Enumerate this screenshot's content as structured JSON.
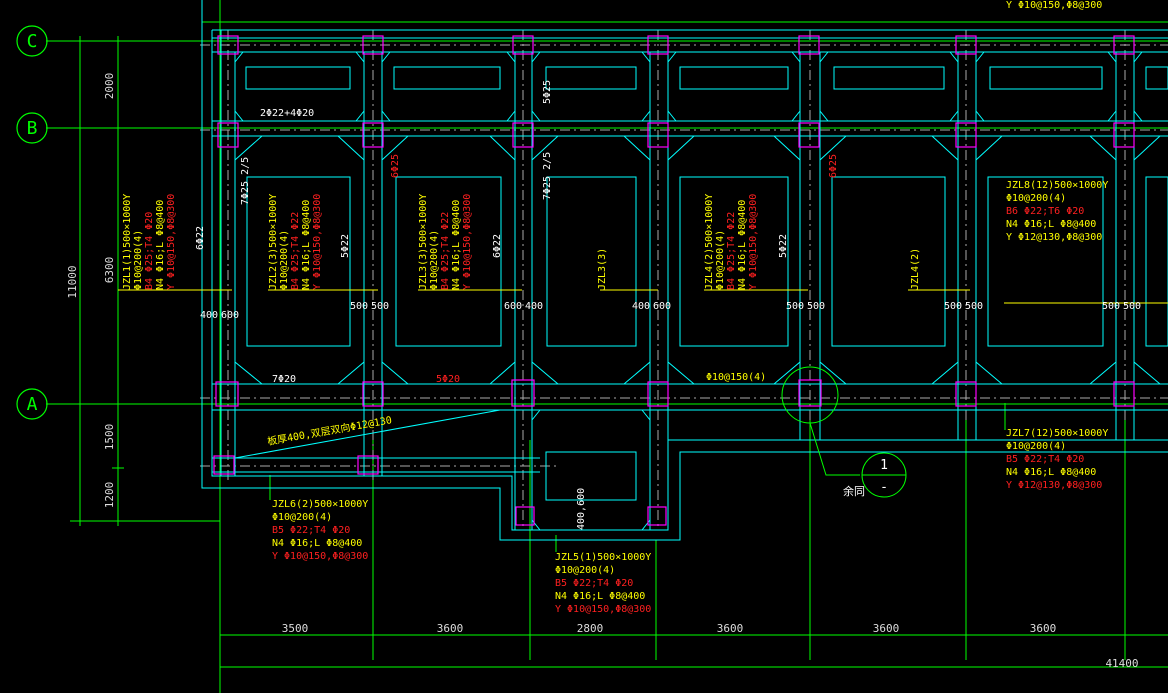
{
  "colors": {
    "background": "#000000",
    "axis": "#00ff00",
    "beam_outline": "#00ffff",
    "column": "#ff00ff",
    "annotation_main": "#ffff00",
    "annotation_extra": "#ff2020",
    "dimension_text": "#dddddd"
  },
  "axes": [
    "C",
    "B",
    "A"
  ],
  "top_note": "Y Φ10@150,Φ8@300",
  "vertical_dims": [
    "2000",
    "6300",
    "1500",
    "1200"
  ],
  "vertical_total": "11000",
  "bottom_dims": [
    "3500",
    "3600",
    "2800",
    "3600",
    "3600",
    "3600"
  ],
  "bottom_total": "41400",
  "beam_labels": {
    "jzl1": [
      "JZL1(1)500×1000Y",
      "Φ10@200(4)",
      "B4 Φ25;T4 Φ20",
      "N4 Φ16;L Φ8@400",
      "Y Φ10@150,Φ8@300"
    ],
    "jzl2": [
      "JZL2(3)500×1000Y",
      "Φ10@200(4)",
      "B4 Φ25;T4 Φ22",
      "N4 Φ16;L Φ8@400",
      "Y Φ10@150,Φ8@300"
    ],
    "jzl3": [
      "JZL3(3)500×1000Y",
      "Φ10@200(4)",
      "B4 Φ25;T4 Φ22",
      "N4 Φ16;L Φ8@400",
      "Y Φ10@150,Φ8@300"
    ],
    "jzl4": [
      "JZL4(2)500×1000Y",
      "Φ10@200(4)",
      "B4 Φ25;T4 Φ22",
      "N4 Φ16;L Φ8@400",
      "Y Φ10@150,Φ8@300"
    ],
    "jzl3_short": "JZL3(3)",
    "jzl4_short": "JZL4(2)",
    "jzl8": [
      "JZL8(12)500×1000Y",
      "Φ10@200(4)",
      "B6 Φ22;T6 Φ20",
      "N4 Φ16;L Φ8@400",
      "Y Φ12@130,Φ8@300"
    ],
    "jzl7": [
      "JZL7(12)500×1000Y",
      "Φ10@200(4)",
      "B5 Φ22;T4 Φ20",
      "N4 Φ16;L Φ8@400",
      "Y Φ12@130,Φ8@300"
    ],
    "jzl6": [
      "JZL6(2)500×1000Y",
      "Φ10@200(4)",
      "B5 Φ22;T4 Φ20",
      "N4 Φ16;L Φ8@400",
      "Y Φ10@150,Φ8@300"
    ],
    "jzl5": [
      "JZL5(1)500×1000Y",
      "Φ10@200(4)",
      "B5 Φ22;T4 Φ20",
      "N4 Φ16;L Φ8@400",
      "Y Φ10@150,Φ8@300"
    ]
  },
  "rebar_notes": {
    "top_span": "2Φ22+4Φ20",
    "n1": "5Φ25",
    "v1": "7Φ25 2/5",
    "v2": "6Φ25",
    "v3": "7Φ25 2/5",
    "v4": "6Φ25",
    "s1": "6Φ22",
    "s2": "5Φ22",
    "s3": "6Φ22",
    "s4": "5Φ22",
    "bot1": "7Φ20",
    "bot2": "5Φ20",
    "stirrup": "Φ10@150(4)",
    "slab": "板厚400,双层双向Φ12@130"
  },
  "offset_labels": [
    "400",
    "600",
    "500",
    "500",
    "600",
    "400",
    "400",
    "600",
    "500",
    "500",
    "500",
    "500",
    "500",
    "500"
  ],
  "offset_label_bottom": "400,600",
  "detail": {
    "number": "1",
    "sub": "-",
    "note": "余同"
  }
}
